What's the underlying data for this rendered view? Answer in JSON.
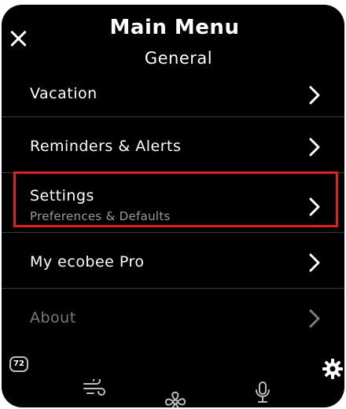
{
  "header": {
    "title": "Main Menu",
    "subtitle": "General"
  },
  "menu": {
    "items": [
      {
        "label": "Vacation",
        "sublabel": "",
        "enabled": true
      },
      {
        "label": "Reminders & Alerts",
        "sublabel": "",
        "enabled": true
      },
      {
        "label": "Settings",
        "sublabel": "Preferences & Defaults",
        "enabled": true,
        "highlighted": true
      },
      {
        "label": "My ecobee Pro",
        "sublabel": "",
        "enabled": true
      },
      {
        "label": "About",
        "sublabel": "",
        "enabled": false
      }
    ]
  },
  "footer": {
    "temperature_badge": "72",
    "icons": [
      "air-quality-icon",
      "fan-icon",
      "microphone-icon",
      "gear-icon"
    ]
  },
  "colors": {
    "background": "#000000",
    "text": "#ffffff",
    "muted": "#9a9a9a",
    "disabled": "#7b7b7b",
    "highlight_border": "#e02020"
  },
  "icons": {
    "close": "close-icon",
    "chevron": "chevron-right-icon"
  }
}
